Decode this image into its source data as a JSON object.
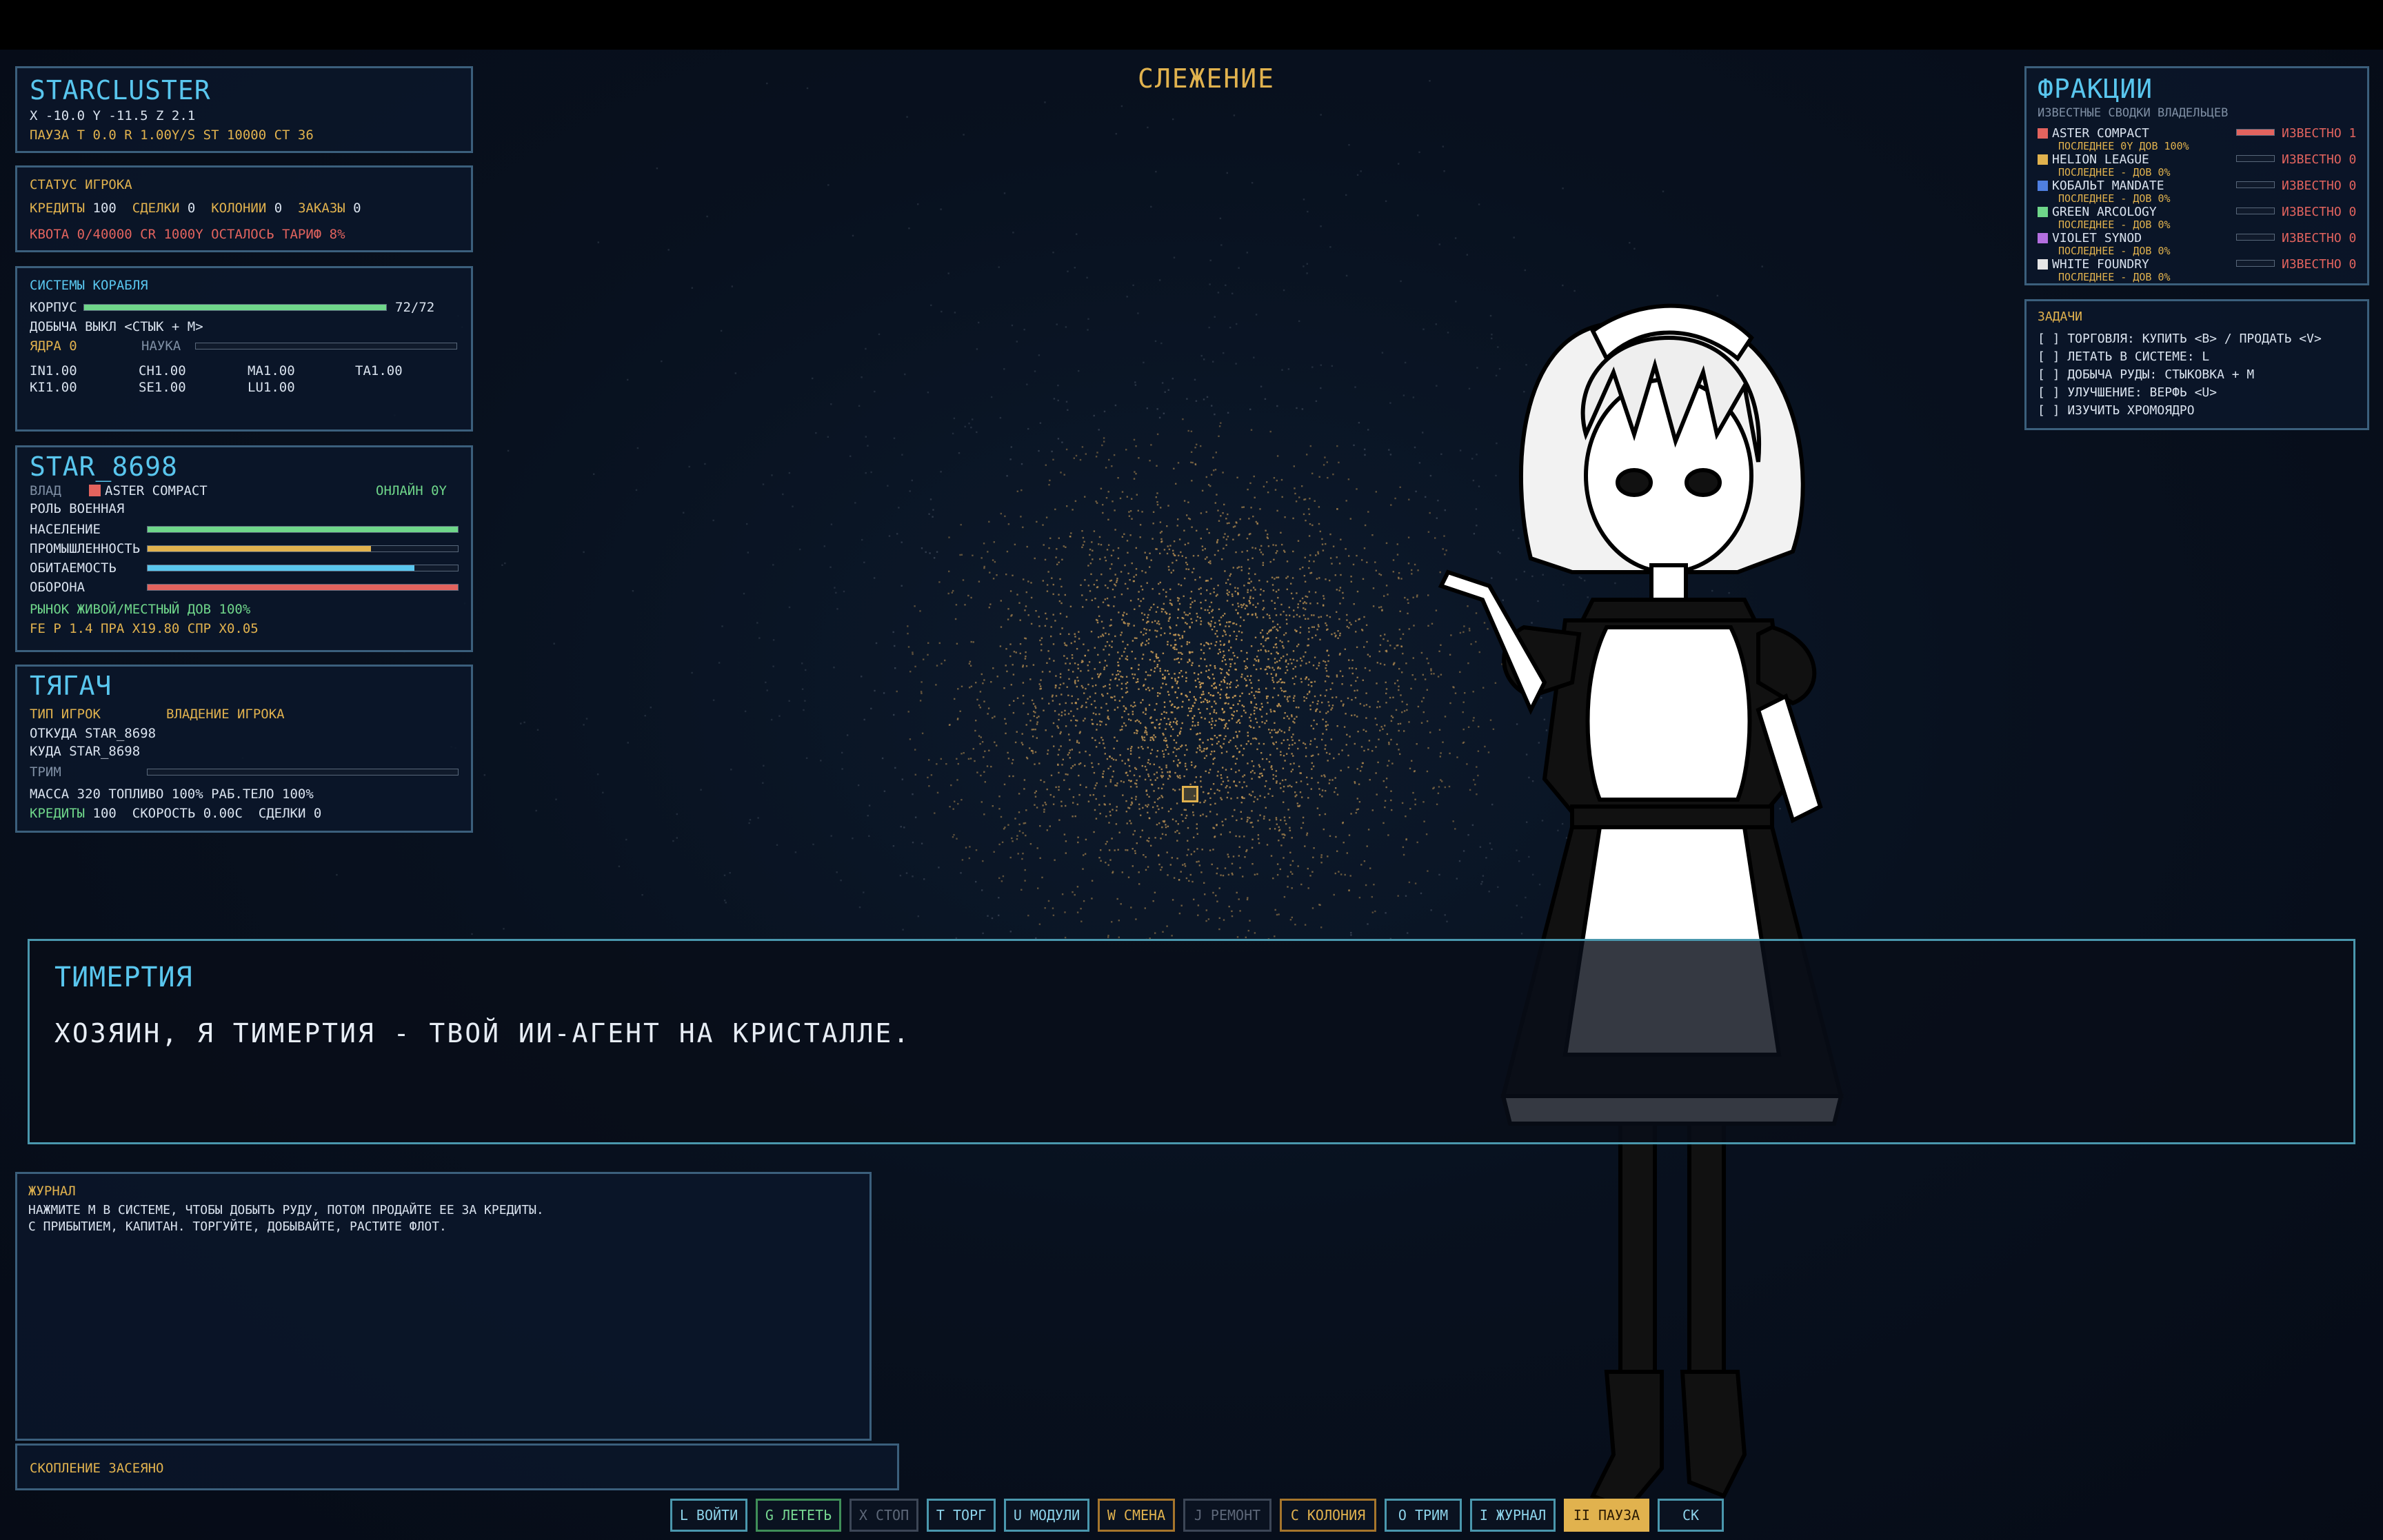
{
  "starcluster": {
    "title": "STARCLUSTER",
    "coords": "X -10.0  Y -11.5  Z 2.1",
    "status": "ПАУЗА  T 0.0  R 1.00Y/S  ST 10000  CT 36"
  },
  "player_status": {
    "title": "СТАТУС ИГРОКА",
    "credits_label": "КРЕДИТЫ",
    "credits": "100",
    "deals_label": "СДЕЛКИ",
    "deals": "0",
    "colonies_label": "КОЛОНИИ",
    "colonies": "0",
    "orders_label": "ЗАКАЗЫ",
    "orders": "0",
    "quota": "КВОТА 0/40000 CR  1000Y ОСТАЛОСЬ  ТАРИФ 8%"
  },
  "ship_systems": {
    "title": "СИСТЕМЫ КОРАБЛЯ",
    "hull_label": "КОРПУС",
    "hull_value": "72/72",
    "hull_fraction": 1.0,
    "mining_label": "ДОБЫЧА ВЫКЛ  <СТЫК + M>",
    "cores_label": "ЯДРА 0",
    "science_label": "НАУКА",
    "science_fraction": 0.0,
    "stats_row1": [
      "IN1.00",
      "CH1.00",
      "MA1.00",
      "TA1.00"
    ],
    "stats_row2": [
      "KI1.00",
      "SE1.00",
      "LU1.00"
    ]
  },
  "star": {
    "title": "STAR_8698",
    "owner_label": "ВЛАД",
    "owner": "ASTER COMPACT",
    "online": "ОНЛАЙН 0Y",
    "role": "РОЛЬ ВОЕННАЯ",
    "bars": [
      {
        "label": "НАСЕЛЕНИЕ",
        "fraction": 1.0,
        "color": "#6fd68a"
      },
      {
        "label": "ПРОМЫШЛЕННОСТЬ",
        "fraction": 0.72,
        "color": "#e1b24e"
      },
      {
        "label": "ОБИТАЕМОСТЬ",
        "fraction": 0.86,
        "color": "#59c6ee"
      },
      {
        "label": "ОБОРОНА",
        "fraction": 1.0,
        "color": "#e2635e"
      }
    ],
    "market": "РЫНОК ЖИВОЙ/МЕСТНЫЙ ДОВ 100%",
    "prices": "FE P 1.4 ПРА X19.80 СПР X0.05"
  },
  "tug": {
    "title": "ТЯГАЧ",
    "type": "ТИП ИГРОК",
    "ownership": "ВЛАДЕНИЕ ИГРОКА",
    "from": "ОТКУДА STAR_8698",
    "to": "КУДА   STAR_8698",
    "trim_label": "ТРИМ",
    "trim_fraction": 0.0,
    "mass_row": "МАССА 320  ТОПЛИВО 100%  РАБ.ТЕЛО 100%",
    "credits_label": "КРЕДИТЫ",
    "credits": "100",
    "speed": "СКОРОСТЬ 0.00C",
    "deals": "СДЕЛКИ 0"
  },
  "tracking_title": "СЛЕЖЕНИЕ",
  "factions": {
    "title": "ФРАКЦИИ",
    "subtitle": "ИЗВЕСТНЫЕ СВОДКИ ВЛАДЕЛЬЦЕВ",
    "items": [
      {
        "name": "ASTER COMPACT",
        "color": "#e2635e",
        "sub": "ПОСЛЕДНЕЕ 0Y ДОВ 100%",
        "known": "ИЗВЕСТНО 1",
        "fraction": 1.0
      },
      {
        "name": "HELION LEAGUE",
        "color": "#e1b24e",
        "sub": "ПОСЛЕДНЕЕ - ДОВ 0%",
        "known": "ИЗВЕСТНО 0",
        "fraction": 0.0
      },
      {
        "name": "КОБАЛЬТ MANDATE",
        "color": "#4f7fe0",
        "sub": "ПОСЛЕДНЕЕ - ДОВ 0%",
        "known": "ИЗВЕСТНО 0",
        "fraction": 0.0
      },
      {
        "name": "GREEN ARCOLOGY",
        "color": "#6fd68a",
        "sub": "ПОСЛЕДНЕЕ - ДОВ 0%",
        "known": "ИЗВЕСТНО 0",
        "fraction": 0.0
      },
      {
        "name": "VIOLET SYNOD",
        "color": "#b46fe0",
        "sub": "ПОСЛЕДНЕЕ - ДОВ 0%",
        "known": "ИЗВЕСТНО 0",
        "fraction": 0.0
      },
      {
        "name": "WHITE FOUNDRY",
        "color": "#e6e6e6",
        "sub": "ПОСЛЕДНЕЕ - ДОВ 0%",
        "known": "ИЗВЕСТНО 0",
        "fraction": 0.0
      }
    ]
  },
  "tasks": {
    "title": "ЗАДАЧИ",
    "items": [
      "[ ] ТОРГОВЛЯ: КУПИТЬ <B> / ПРОДАТЬ <V>",
      "[ ] ЛЕТАТЬ В СИСТЕМЕ: L",
      "[ ] ДОБЫЧА РУДЫ: СТЫКОВКА + M",
      "[ ] УЛУЧШЕНИЕ: ВЕРФЬ <U>",
      "[ ] ИЗУЧИТЬ ХРОМОЯДРО"
    ]
  },
  "dialog": {
    "speaker": "ТИМЕРТИЯ",
    "text": "ХОЗЯИН, Я ТИМЕРТИЯ - ТВОЙ ИИ-АГЕНТ НА КРИСТАЛЛЕ."
  },
  "journal": {
    "title": "ЖУРНАЛ",
    "lines": [
      "НАЖМИТЕ M В СИСТЕМЕ, ЧТОБЫ ДОБЫТЬ РУДУ, ПОТОМ ПРОДАЙТЕ ЕЕ ЗА КРЕДИТЫ.",
      "С ПРИБЫТИЕМ, КАПИТАН. ТОРГУЙТЕ, ДОБЫВАЙТЕ, РАСТИТЕ ФЛОТ."
    ]
  },
  "status_line": "СКОПЛЕНИЕ ЗАСЕЯНО",
  "hotkeys": [
    {
      "label": "L ВОЙТИ",
      "style": "blue"
    },
    {
      "label": "G ЛЕТЕТЬ",
      "style": "green"
    },
    {
      "label": "X СТОП",
      "style": "gray"
    },
    {
      "label": "T ТОРГ",
      "style": "blue"
    },
    {
      "label": "U МОДУЛИ",
      "style": "blue"
    },
    {
      "label": "W СМЕНА",
      "style": "orange"
    },
    {
      "label": "J РЕМОНТ",
      "style": "gray"
    },
    {
      "label": "C КОЛОНИЯ",
      "style": "orange"
    },
    {
      "label": "O ТРИМ",
      "style": "blue"
    },
    {
      "label": "I ЖУРНАЛ",
      "style": "blue"
    },
    {
      "label": "II ПАУЗА",
      "style": "active"
    },
    {
      "label": "СК",
      "style": "blue"
    }
  ]
}
